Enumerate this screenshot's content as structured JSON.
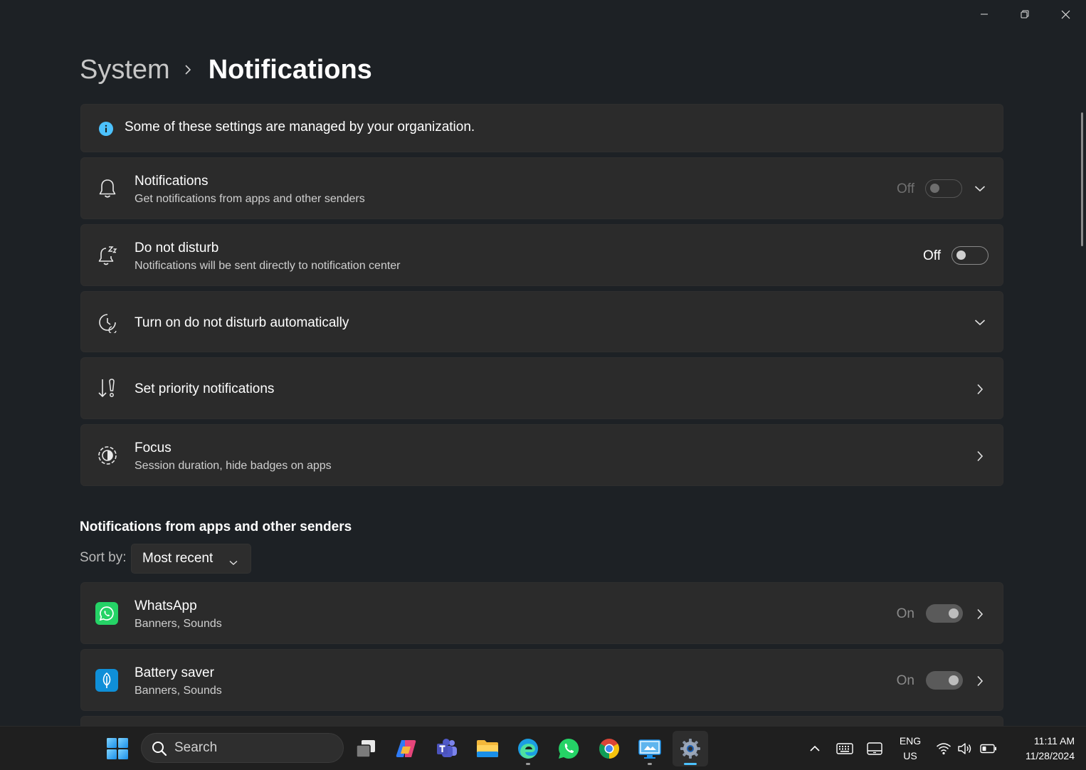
{
  "breadcrumb": {
    "parent": "System",
    "current": "Notifications"
  },
  "banner": {
    "text": "Some of these settings are managed by your organization.",
    "icon": "info-icon",
    "icon_color": "#4cc2ff"
  },
  "settings": {
    "notifications": {
      "title": "Notifications",
      "subtitle": "Get notifications from apps and other senders",
      "state": "Off",
      "icon": "bell-icon"
    },
    "dnd": {
      "title": "Do not disturb",
      "subtitle": "Notifications will be sent directly to notification center",
      "state": "Off",
      "icon": "bell-snooze-icon"
    },
    "dnd_auto": {
      "title": "Turn on do not disturb automatically",
      "icon": "clock-icon"
    },
    "priority": {
      "title": "Set priority notifications",
      "icon": "priority-icon"
    },
    "focus": {
      "title": "Focus",
      "subtitle": "Session duration, hide badges on apps",
      "icon": "focus-icon"
    }
  },
  "apps_section": {
    "title": "Notifications from apps and other senders",
    "sort_label": "Sort by:",
    "sort_value": "Most recent",
    "apps": [
      {
        "name": "WhatsApp",
        "subtitle": "Banners, Sounds",
        "state": "On",
        "icon": "whatsapp-icon",
        "color": "#25d366"
      },
      {
        "name": "Battery saver",
        "subtitle": "Banners, Sounds",
        "state": "On",
        "icon": "battery-saver-icon",
        "color": "#0f8fd8"
      }
    ]
  },
  "taskbar": {
    "search_placeholder": "Search",
    "lang_top": "ENG",
    "lang_bottom": "US",
    "time": "11:11 AM",
    "date": "11/28/2024"
  },
  "accent_color": "#4cc2ff"
}
